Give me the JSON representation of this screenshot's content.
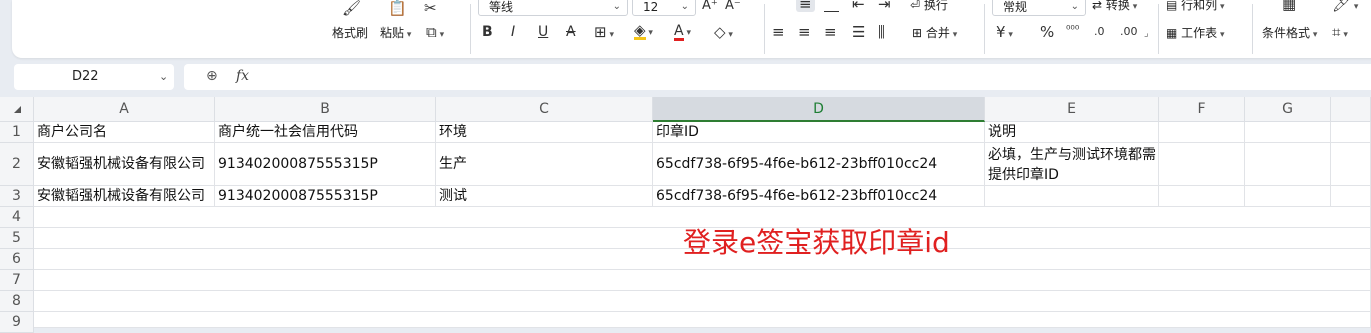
{
  "ribbon": {
    "format_painter": "格式刷",
    "paste": "粘贴",
    "font_name": "等线",
    "font_size": "12",
    "merge": "合并",
    "wrap": "换行",
    "number_format": "常规",
    "convert": "转换",
    "rows_cols": "行和列",
    "worksheet": "工作表",
    "conditional_format": "条件格式",
    "currency_symbol": "¥",
    "percent_symbol": "%"
  },
  "formula_bar": {
    "cell_ref": "D22",
    "fx": "fx",
    "content": ""
  },
  "sheet": {
    "columns": [
      "A",
      "B",
      "C",
      "D",
      "E",
      "F",
      "G"
    ],
    "selected_column": "D",
    "rows": [
      "1",
      "2",
      "3",
      "4",
      "5",
      "6",
      "7",
      "8",
      "9"
    ],
    "cells": {
      "r1": [
        "商户公司名",
        "商户统一社会信用代码",
        "环境",
        "印章ID",
        "说明"
      ],
      "r2": [
        "安徽韬强机械设备有限公司",
        "91340200087555315P",
        "生产",
        "65cdf738-6f95-4f6e-b612-23bff010cc24",
        "必填，生产与测试环境都需提供印章ID"
      ],
      "r3": [
        "安徽韬强机械设备有限公司",
        "91340200087555315P",
        "测试",
        "65cdf738-6f95-4f6e-b612-23bff010cc24",
        ""
      ]
    }
  },
  "annotation": "登录e签宝获取印章id",
  "colors": {
    "accent_green": "#2e7d32",
    "annotation_red": "#e02020",
    "highlight_yellow": "#f5c518",
    "font_color_red": "#e02020"
  }
}
